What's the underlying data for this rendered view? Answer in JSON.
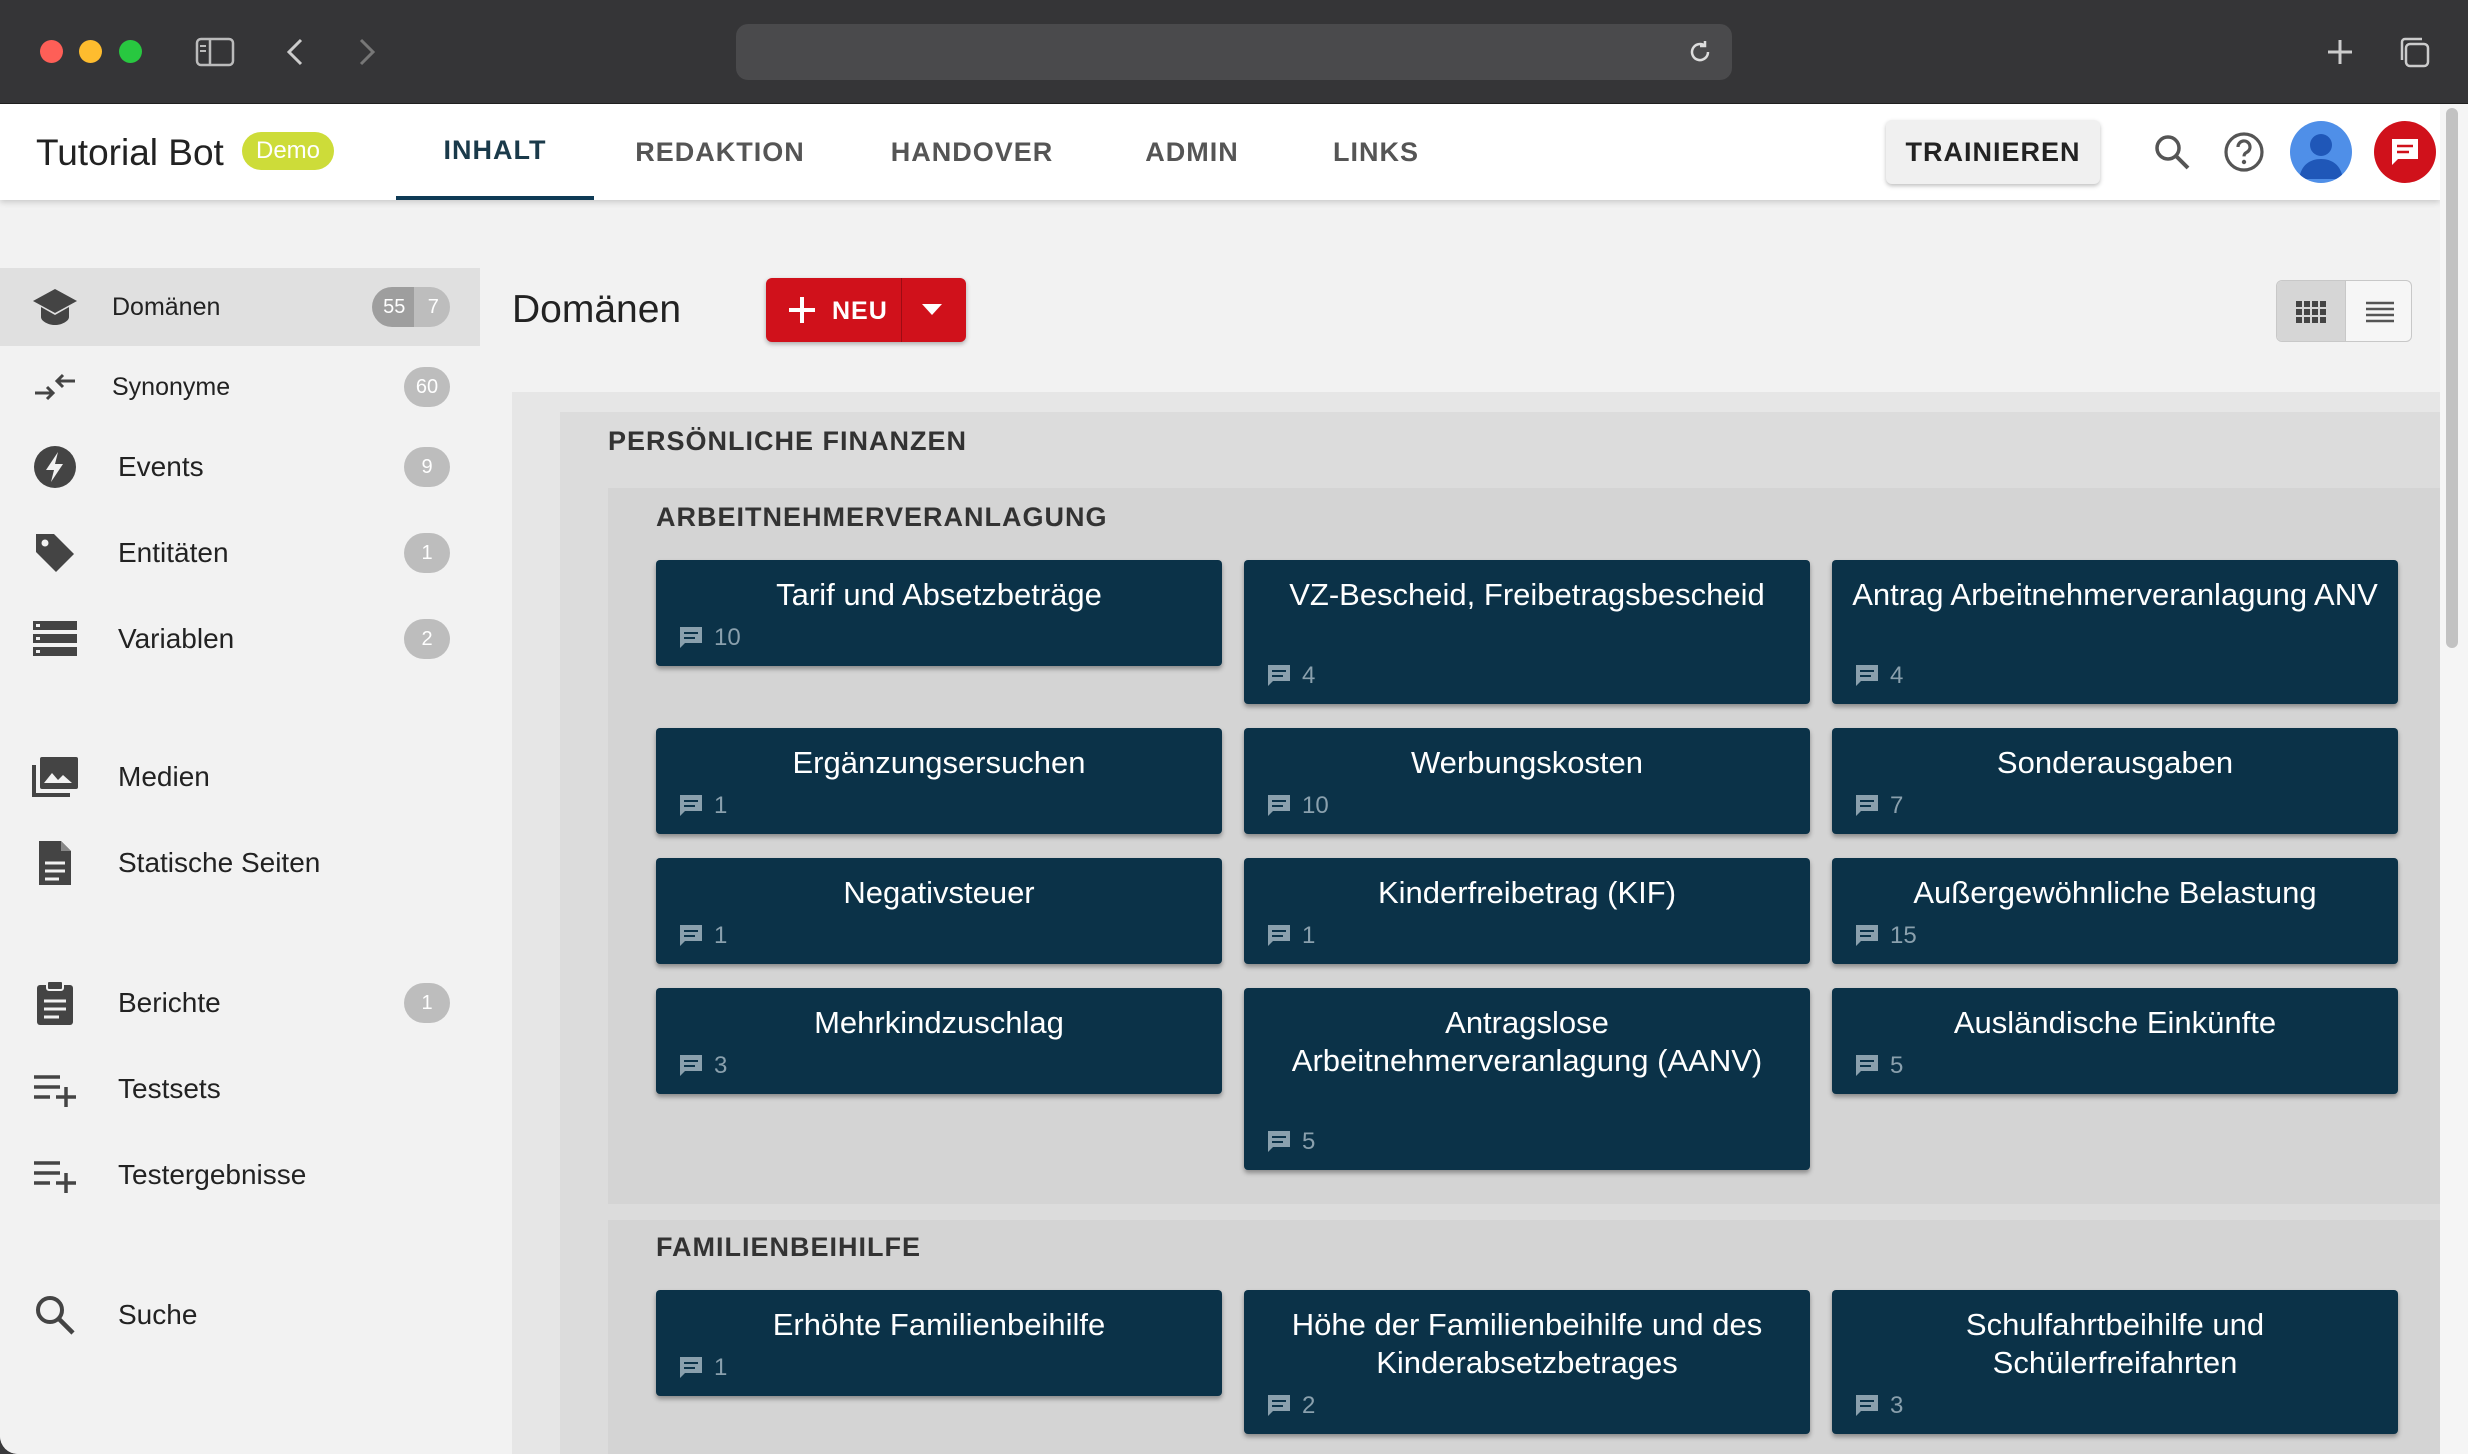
{
  "app": {
    "title": "Tutorial Bot",
    "badge": "Demo"
  },
  "nav": {
    "tabs": [
      "INHALT",
      "REDAKTION",
      "HANDOVER",
      "ADMIN",
      "LINKS"
    ],
    "active_tab": "INHALT",
    "train_label": "TRAINIEREN"
  },
  "sidebar": {
    "items": [
      {
        "label": "Domänen",
        "count": "55",
        "count2": "7",
        "icon": "school-icon"
      },
      {
        "label": "Synonyme",
        "count": "60",
        "icon": "swap-icon"
      },
      {
        "label": "Events",
        "count": "9",
        "icon": "bolt-icon"
      },
      {
        "label": "Entitäten",
        "count": "1",
        "icon": "tag-icon"
      },
      {
        "label": "Variablen",
        "count": "2",
        "icon": "storage-icon"
      },
      {
        "label": "Medien",
        "icon": "photo-library-icon"
      },
      {
        "label": "Statische Seiten",
        "icon": "document-icon"
      },
      {
        "label": "Berichte",
        "count": "1",
        "icon": "clipboard-icon"
      },
      {
        "label": "Testsets",
        "icon": "playlist-add-icon"
      },
      {
        "label": "Testergebnisse",
        "icon": "playlist-add-icon"
      },
      {
        "label": "Suche",
        "icon": "search-icon"
      }
    ]
  },
  "main": {
    "title": "Domänen",
    "new_label": "NEU",
    "sections": [
      {
        "title": "PERSÖNLICHE FINANZEN",
        "groups": [
          {
            "title": "ARBEITNEHMERVERANLAGUNG",
            "cards": [
              {
                "title": "Tarif und Absetzbeträge",
                "count": "10"
              },
              {
                "title": "VZ-Bescheid, Freibetragsbescheid",
                "count": "4"
              },
              {
                "title": "Antrag Arbeitnehmerveranlagung ANV",
                "count": "4"
              },
              {
                "title": "Ergänzungsersuchen",
                "count": "1"
              },
              {
                "title": "Werbungskosten",
                "count": "10"
              },
              {
                "title": "Sonderausgaben",
                "count": "7"
              },
              {
                "title": "Negativsteuer",
                "count": "1"
              },
              {
                "title": "Kinderfreibetrag (KIF)",
                "count": "1"
              },
              {
                "title": "Außergewöhnliche Belastung",
                "count": "15"
              },
              {
                "title": "Mehrkindzuschlag",
                "count": "3"
              },
              {
                "title": "Antragslose Arbeitnehmerveranlagung (AANV)",
                "count": "5"
              },
              {
                "title": "Ausländische Einkünfte",
                "count": "5"
              }
            ]
          },
          {
            "title": "FAMILIENBEIHILFE",
            "cards": [
              {
                "title": "Erhöhte Familienbeihilfe",
                "count": "1"
              },
              {
                "title": "Höhe der Familienbeihilfe und des Kinderabsetzbetrages",
                "count": "2"
              },
              {
                "title": "Schulfahrtbeihilfe und Schülerfreifahrten",
                "count": "3"
              }
            ]
          }
        ]
      }
    ]
  },
  "colors": {
    "brand_red": "#d0111b",
    "card_bg": "#0b3248",
    "badge_green": "#cddc39",
    "avatar_blue": "#4f8fe8"
  }
}
